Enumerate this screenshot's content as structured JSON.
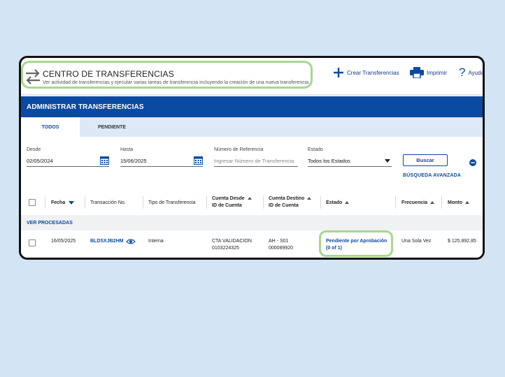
{
  "header": {
    "title": "CENTRO DE TRANSFERENCIAS",
    "subtitle": "Ver actividad de transferencias y ejecutar varias tareas de transferencia incluyendo la creación de una nueva transferencia",
    "actions": [
      {
        "label": "Crear Transferencias",
        "icon": "plus-icon"
      },
      {
        "label": "Imprimir",
        "icon": "printer-icon"
      },
      {
        "label": "Ayuda",
        "icon": "help-icon"
      }
    ]
  },
  "section_title": "ADMINISTRAR TRANSFERENCIAS",
  "tabs": [
    {
      "label": "TODOS",
      "active": true
    },
    {
      "label": "PENDIENTE",
      "active": false
    }
  ],
  "filters": {
    "desde": {
      "label": "Desde",
      "value": "02/05/2024"
    },
    "hasta": {
      "label": "Hasta",
      "value": "15/06/2025"
    },
    "referencia": {
      "label": "Número de Referencia",
      "placeholder": "Ingresar Número de Transferencia"
    },
    "estado": {
      "label": "Estado",
      "value": "Todos los Estados"
    },
    "search_button": "Buscar",
    "advanced_link": "BÚSQUEDA AVANZADA"
  },
  "table": {
    "columns": {
      "fecha": "Fecha",
      "transaccion": "Transacción No.",
      "tipo": "Tipo de Transferencia",
      "cuenta_desde": "Cuenta Desde",
      "cuenta_desde_sub": "ID de Cuenta",
      "cuenta_destino": "Cuenta Destino",
      "cuenta_destino_sub": "ID de Cuenta",
      "estado": "Estado",
      "frecuencia": "Frecuencia",
      "monto": "Monto"
    },
    "group_label": "VER PROCESADAS",
    "rows": [
      {
        "fecha": "16/05/2025",
        "transaccion": "BLDSXJB2HM",
        "tipo": "Interna",
        "cuenta_desde": "CTA VALIDACION",
        "cuenta_desde_id": "0103224325",
        "cuenta_destino": "AH - S01",
        "cuenta_destino_id": "000089920",
        "estado": "Pendiente por Aprobación",
        "estado_detail": "(0 of 1)",
        "frecuencia": "Una Sola Vez",
        "monto": "$ 125.892,85"
      }
    ]
  },
  "colors": {
    "primary": "#0b4aa2",
    "highlight": "#a5d98c",
    "background": "#d3e4f5"
  }
}
